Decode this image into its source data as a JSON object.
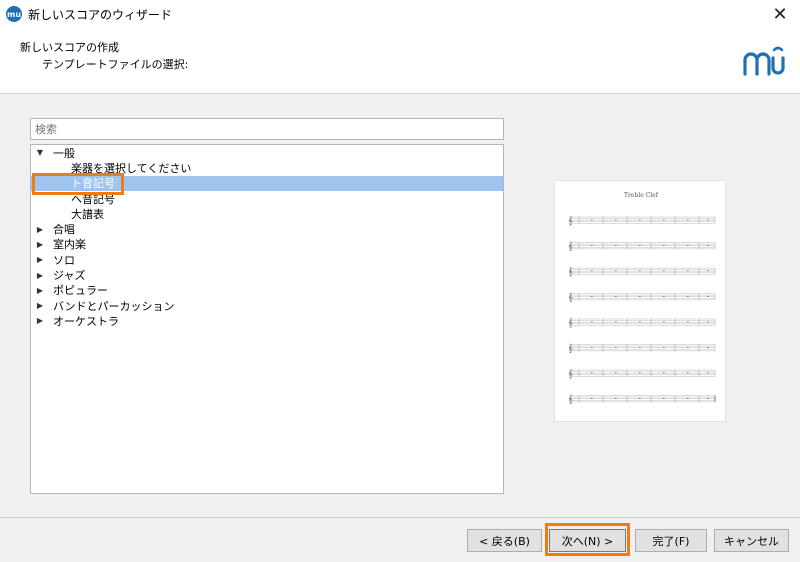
{
  "window": {
    "app_icon": "mu",
    "title": "新しいスコアのウィザード",
    "close_glyph": "✕"
  },
  "header": {
    "title": "新しいスコアの作成",
    "subtitle": "テンプレートファイルの選択:",
    "logo_icon": "musescore-logo-icon",
    "logo_color": "#1f6fb2"
  },
  "search": {
    "placeholder": "検索",
    "value": ""
  },
  "tree": {
    "rows": [
      {
        "label": "一般",
        "level": 0,
        "expanded": true
      },
      {
        "label": "楽器を選択してください",
        "level": 1
      },
      {
        "label": "ト音記号",
        "level": 1,
        "selected": true
      },
      {
        "label": "ヘ音記号",
        "level": 1
      },
      {
        "label": "大譜表",
        "level": 1
      },
      {
        "label": "合唱",
        "level": 0,
        "expanded": false
      },
      {
        "label": "室内楽",
        "level": 0,
        "expanded": false
      },
      {
        "label": "ソロ",
        "level": 0,
        "expanded": false
      },
      {
        "label": "ジャズ",
        "level": 0,
        "expanded": false
      },
      {
        "label": "ポピュラー",
        "level": 0,
        "expanded": false
      },
      {
        "label": "バンドとパーカッション",
        "level": 0,
        "expanded": false
      },
      {
        "label": "オーケストラ",
        "level": 0,
        "expanded": false
      }
    ],
    "selected_color": "#9ec5f0",
    "highlight_color": "#ee7d11"
  },
  "preview": {
    "title": "Treble Clef",
    "staff_count": 8
  },
  "footer": {
    "back_label": "< 戻る(B)",
    "next_label": "次へ(N) >",
    "finish_label": "完了(F)",
    "cancel_label": "キャンセル"
  }
}
